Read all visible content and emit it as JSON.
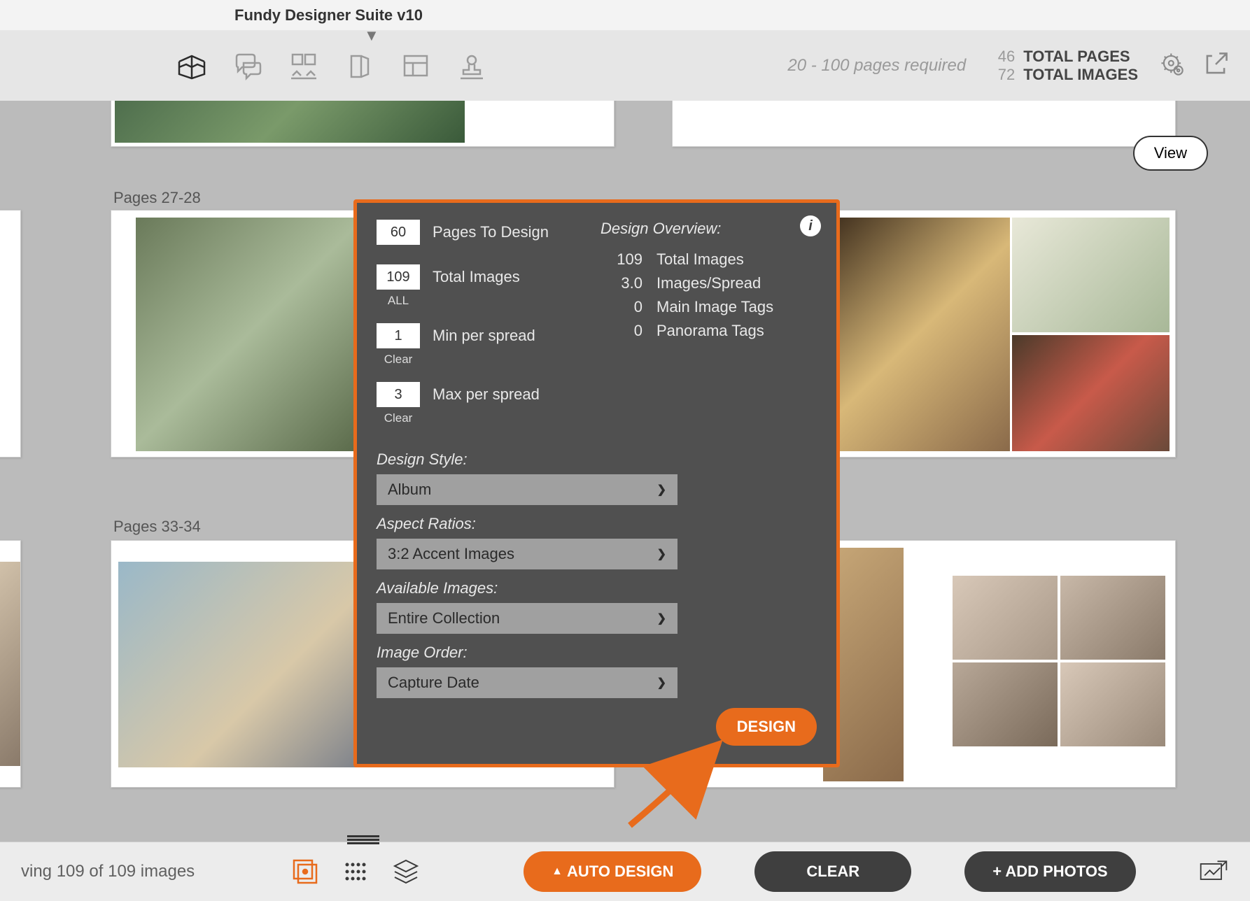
{
  "app": {
    "title": "Fundy Designer Suite v10"
  },
  "toolbar": {
    "req_text": "20 - 100 pages required",
    "total_pages_num": "46",
    "total_pages_lbl": "TOTAL PAGES",
    "total_images_num": "72",
    "total_images_lbl": "TOTAL IMAGES"
  },
  "view_btn": "View",
  "spreads": {
    "s27": "Pages 27-28",
    "s33": "Pages 33-34"
  },
  "modal": {
    "pages_to_design": {
      "value": "60",
      "label": "Pages To Design"
    },
    "total_images": {
      "value": "109",
      "label": "Total Images",
      "sub": "ALL"
    },
    "min_per_spread": {
      "value": "1",
      "label": "Min per spread",
      "sub": "Clear"
    },
    "max_per_spread": {
      "value": "3",
      "label": "Max per spread",
      "sub": "Clear"
    },
    "overview_title": "Design Overview:",
    "overview": {
      "total_images": {
        "num": "109",
        "lbl": "Total Images"
      },
      "images_spread": {
        "num": "3.0",
        "lbl": "Images/Spread"
      },
      "main_tags": {
        "num": "0",
        "lbl": "Main Image Tags"
      },
      "pano_tags": {
        "num": "0",
        "lbl": "Panorama Tags"
      }
    },
    "design_style": {
      "label": "Design Style:",
      "value": "Album"
    },
    "aspect_ratios": {
      "label": "Aspect Ratios:",
      "value": "3:2 Accent Images"
    },
    "available_images": {
      "label": "Available Images:",
      "value": "Entire Collection"
    },
    "image_order": {
      "label": "Image Order:",
      "value": "Capture Date"
    },
    "design_btn": "DESIGN"
  },
  "bottombar": {
    "status": "ving 109 of 109 images",
    "auto_design": "AUTO DESIGN",
    "clear": "CLEAR",
    "add_photos": "+ ADD PHOTOS"
  }
}
